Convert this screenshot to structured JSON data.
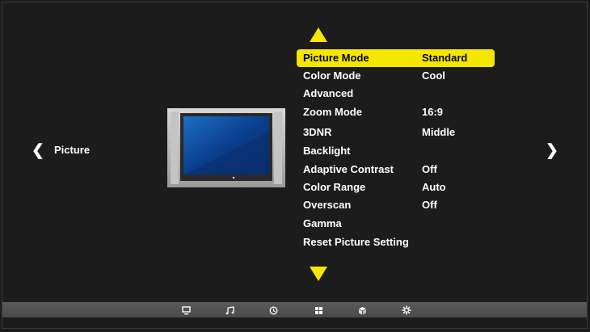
{
  "nav": {
    "left_arrow": "❮",
    "right_arrow": "❯",
    "section_label": "Picture"
  },
  "menu": {
    "items": [
      {
        "label": "Picture Mode",
        "value": "Standard",
        "selected": true
      },
      {
        "label": "Color Mode",
        "value": "Cool"
      },
      {
        "label": "Advanced",
        "value": ""
      },
      {
        "label": "Zoom Mode",
        "value": "16:9"
      },
      {
        "label": "3DNR",
        "value": "Middle"
      },
      {
        "label": "Backlight",
        "value": ""
      },
      {
        "label": "Adaptive Contrast",
        "value": "Off"
      },
      {
        "label": "Color Range",
        "value": "Auto"
      },
      {
        "label": "Overscan",
        "value": "Off"
      },
      {
        "label": "Gamma",
        "value": ""
      },
      {
        "label": "Reset Picture Setting",
        "value": ""
      }
    ]
  },
  "taskbar": {
    "icons": [
      "picture-icon",
      "music-icon",
      "clock-icon",
      "grid-icon",
      "cube-icon",
      "settings-icon"
    ]
  },
  "colors": {
    "accent": "#f5e600",
    "background": "#1c1c1c",
    "taskbar": "#545454"
  }
}
